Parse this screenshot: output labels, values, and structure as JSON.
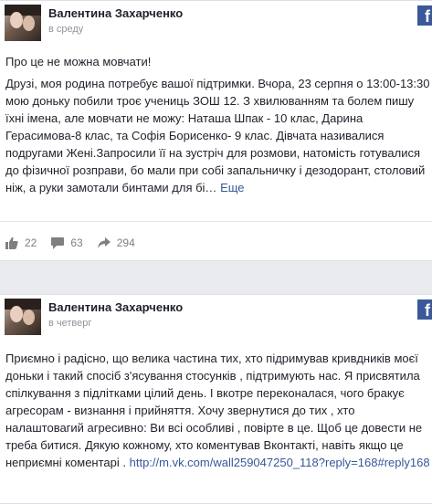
{
  "posts": [
    {
      "author": "Валентина Захарченко",
      "time": "в среду",
      "headline": "Про це не можна мовчати!",
      "body": "Друзі, моя родина потребує вашої підтримки. Вчора, 23 серпня о 13:00-13:30 мою доньку побили троє учениць ЗОШ 12. З хвилюванням та болем пишу їхні імена, але мовчати не можу: Наташа Шпак - 10 клас, Дарина Герасимова-8 клас, та Софія Борисенко- 9 клас. Дівчата називалися подругами Жені.Запросили її на зустріч для розмови, натомість готувалися до фізичної розправи, бо мали при собі запальничку і дезодорант, столовий ніж, а руки замотали бинтами для бі…",
      "more": "Еще",
      "likes": "22",
      "comments": "63",
      "shares": "294"
    },
    {
      "author": "Валентина Захарченко",
      "time": "в четверг",
      "body": "Приємно і радісно, що велика частина тих, хто підримував кривдників моєї доньки і такий спосіб з'ясування стосунків , підтримують нас. Я присвятила спілкування з підлітками цілий день. І вкотре переконалася, чого бракує агресорам - визнання і прийняття. Хочу звернутися до тих , хто налаштовагий агресивно: Ви всі особливі , повірте в це. Щоб це довести не треба битися. Дякую кожному, хто коментував Вконтакті, навіть якщо це неприємні коментарі .",
      "link": "http://m.vk.com/wall259047250_118?reply=168#reply168"
    }
  ],
  "icons": {
    "like": "thumbs-up-icon",
    "comment": "comment-bubble-icon",
    "share": "share-arrow-icon",
    "brand": "facebook-icon"
  },
  "colors": {
    "link": "#365899",
    "facebook_blue": "#3b5998",
    "meta_gray": "#90949c"
  }
}
